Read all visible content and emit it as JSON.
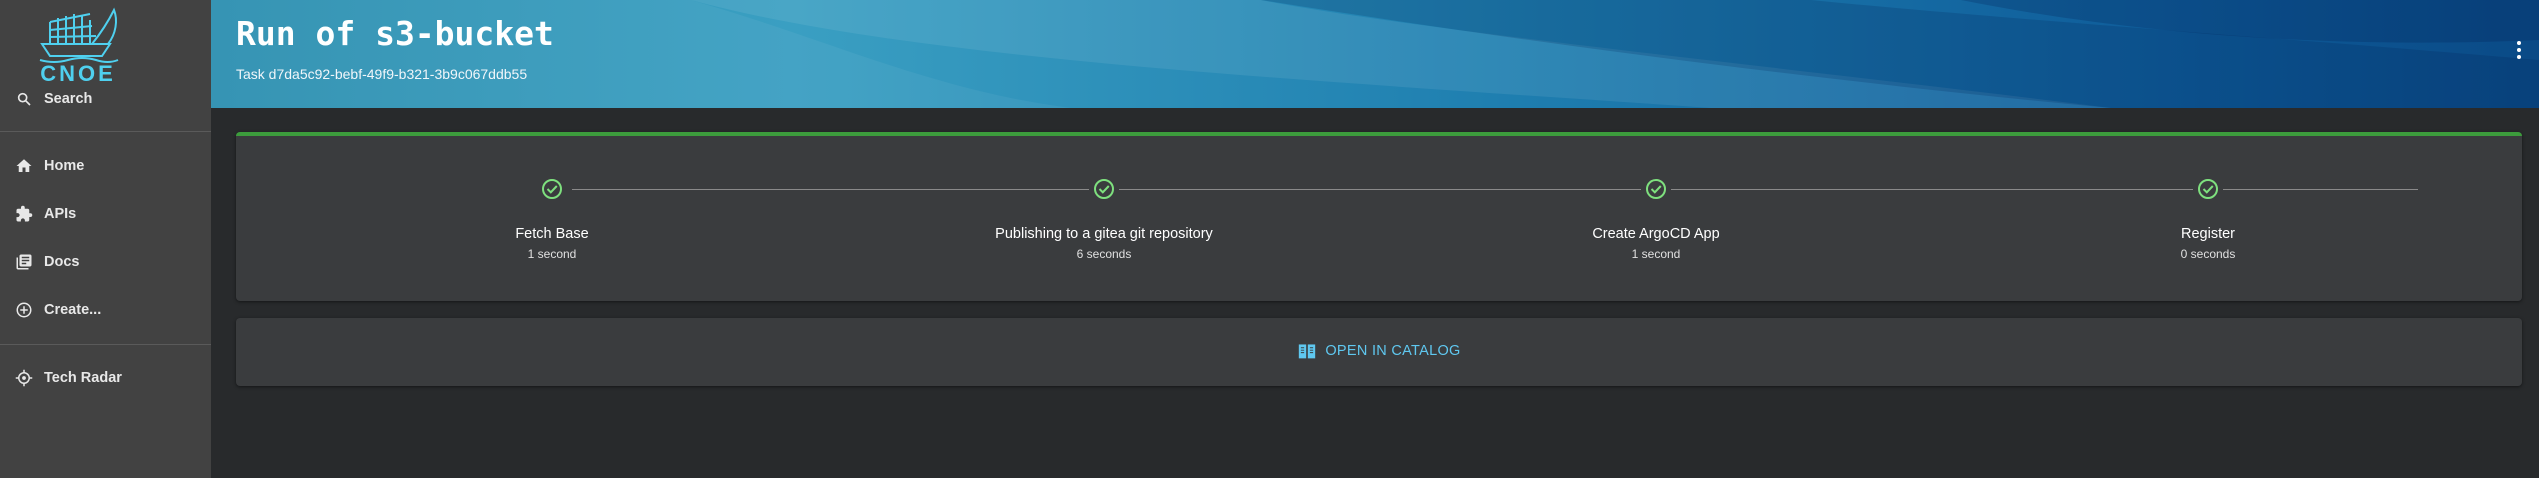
{
  "sidebar": {
    "logo_text": "CNOE",
    "search_label": "Search",
    "items": [
      {
        "label": "Home",
        "icon": "home-icon"
      },
      {
        "label": "APIs",
        "icon": "puzzle-icon"
      },
      {
        "label": "Docs",
        "icon": "docs-icon"
      },
      {
        "label": "Create...",
        "icon": "add-circle-icon"
      }
    ],
    "tech_radar_label": "Tech Radar"
  },
  "header": {
    "title": "Run of s3-bucket",
    "subtitle": "Task d7da5c92-bebf-49f9-b321-3b9c067ddb55"
  },
  "steps": [
    {
      "label": "Fetch Base",
      "time": "1 second",
      "status": "completed"
    },
    {
      "label": "Publishing to a gitea git repository",
      "time": "6 seconds",
      "status": "completed"
    },
    {
      "label": "Create ArgoCD App",
      "time": "1 second",
      "status": "completed"
    },
    {
      "label": "Register",
      "time": "0 seconds",
      "status": "completed"
    }
  ],
  "catalog": {
    "label": "OPEN IN CATALOG",
    "icon": "catalog-book-icon"
  },
  "colors": {
    "sidebar_bg": "#424242",
    "page_bg": "#282a2c",
    "card_bg": "#3a3c3e",
    "accent_green": "#3c9c3c",
    "step_check": "#7ee07e",
    "link_blue": "#5fc8f0"
  }
}
